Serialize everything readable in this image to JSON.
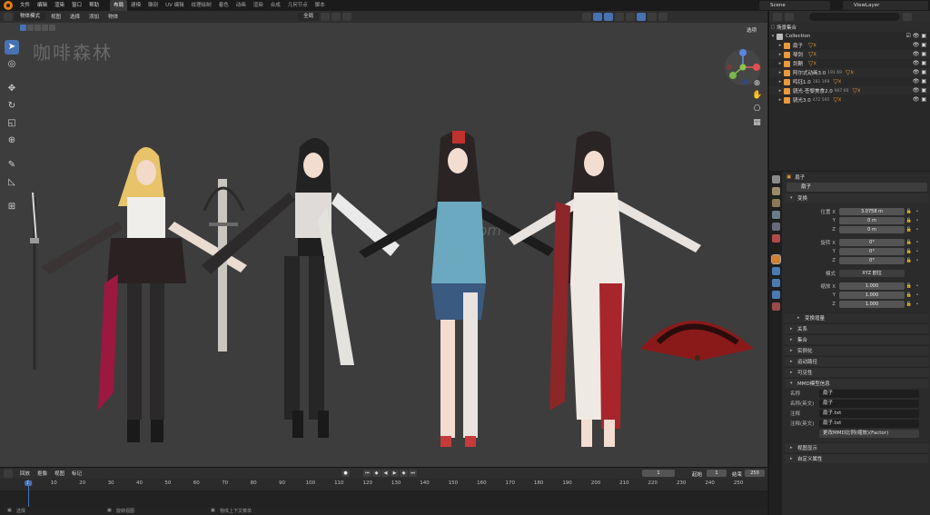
{
  "topbar": {
    "menu": [
      "文件",
      "编辑",
      "渲染",
      "窗口",
      "帮助"
    ],
    "workspaces": [
      "布局",
      "建模",
      "雕刻",
      "UV 编辑",
      "纹理绘制",
      "着色",
      "动画",
      "渲染",
      "合成",
      "几何节点",
      "脚本"
    ],
    "active_workspace": "布局",
    "scene": "Scene",
    "view_layer": "ViewLayer"
  },
  "viewport": {
    "mode": "物体模式",
    "menus": [
      "视图",
      "选择",
      "添加",
      "物体"
    ],
    "transform_orientation": "全局",
    "options_label": "选项",
    "watermark_cn": "咖啡森林",
    "watermark_site": "fslk.com"
  },
  "outliner": {
    "root": "场景集合",
    "collection": "Collection",
    "items": [
      {
        "name": "扇子",
        "sub": ""
      },
      {
        "name": "琴剑",
        "sub": ""
      },
      {
        "name": "剑鞘",
        "sub": ""
      },
      {
        "name": "阿尔式动画3.0",
        "sub": "191 69"
      },
      {
        "name": "鸣钰1.0",
        "sub": "181 169"
      },
      {
        "name": "骁光-苍黎美食2.0",
        "sub": "907 60"
      },
      {
        "name": "骁光3.0",
        "sub": "472 595"
      }
    ]
  },
  "properties": {
    "object_name_header": "扇子",
    "object_name": "扇子",
    "transform_title": "变换",
    "location_label": "位置 X",
    "location": [
      "3.0758 m",
      "0 m",
      "0 m"
    ],
    "rotation_label": "旋转 X",
    "rotation": [
      "0°",
      "0°",
      "0°"
    ],
    "mode_label": "模式",
    "rotation_mode": "XYZ 欧拉",
    "scale_label": "缩放 X",
    "scale": [
      "1.000",
      "1.000",
      "1.000"
    ],
    "axis_y": "Y",
    "axis_z": "Z",
    "delta_transform": "变换增量",
    "panels": [
      "关系",
      "集合",
      "实例化",
      "运动路径",
      "可见性"
    ],
    "mmd_title": "MMD模型信息",
    "mmd_name_label": "名称",
    "mmd_name": "扇子",
    "mmd_name_en_label": "名称(英文)",
    "mmd_name_en": "扇子",
    "mmd_comment_label": "注释",
    "mmd_comment": "扇子.txt",
    "mmd_comment_en_label": "注释(英文)",
    "mmd_comment_en": "扇子.txt",
    "mmd_scale_note": "更改MMD比例(缩放)(Factor)",
    "bottom_panels": [
      "视图显示",
      "自定义属性"
    ]
  },
  "timeline": {
    "menus": [
      "回放",
      "抠像",
      "视图",
      "标记"
    ],
    "current_frame": "1",
    "start_label": "起始",
    "start": "1",
    "end_label": "结束",
    "end": "250",
    "ticks": [
      1,
      10,
      20,
      30,
      40,
      50,
      60,
      70,
      80,
      90,
      100,
      110,
      120,
      130,
      140,
      150,
      160,
      170,
      180,
      190,
      200,
      210,
      220,
      230,
      240,
      250
    ]
  },
  "statusbar": {
    "left": "选择",
    "mid": "旋转视图",
    "right": "物体上下文菜单"
  },
  "colors": {
    "accent": "#4772b3",
    "viewport_bg": "#3d3d3d",
    "panel_bg": "#2b2b2b"
  }
}
